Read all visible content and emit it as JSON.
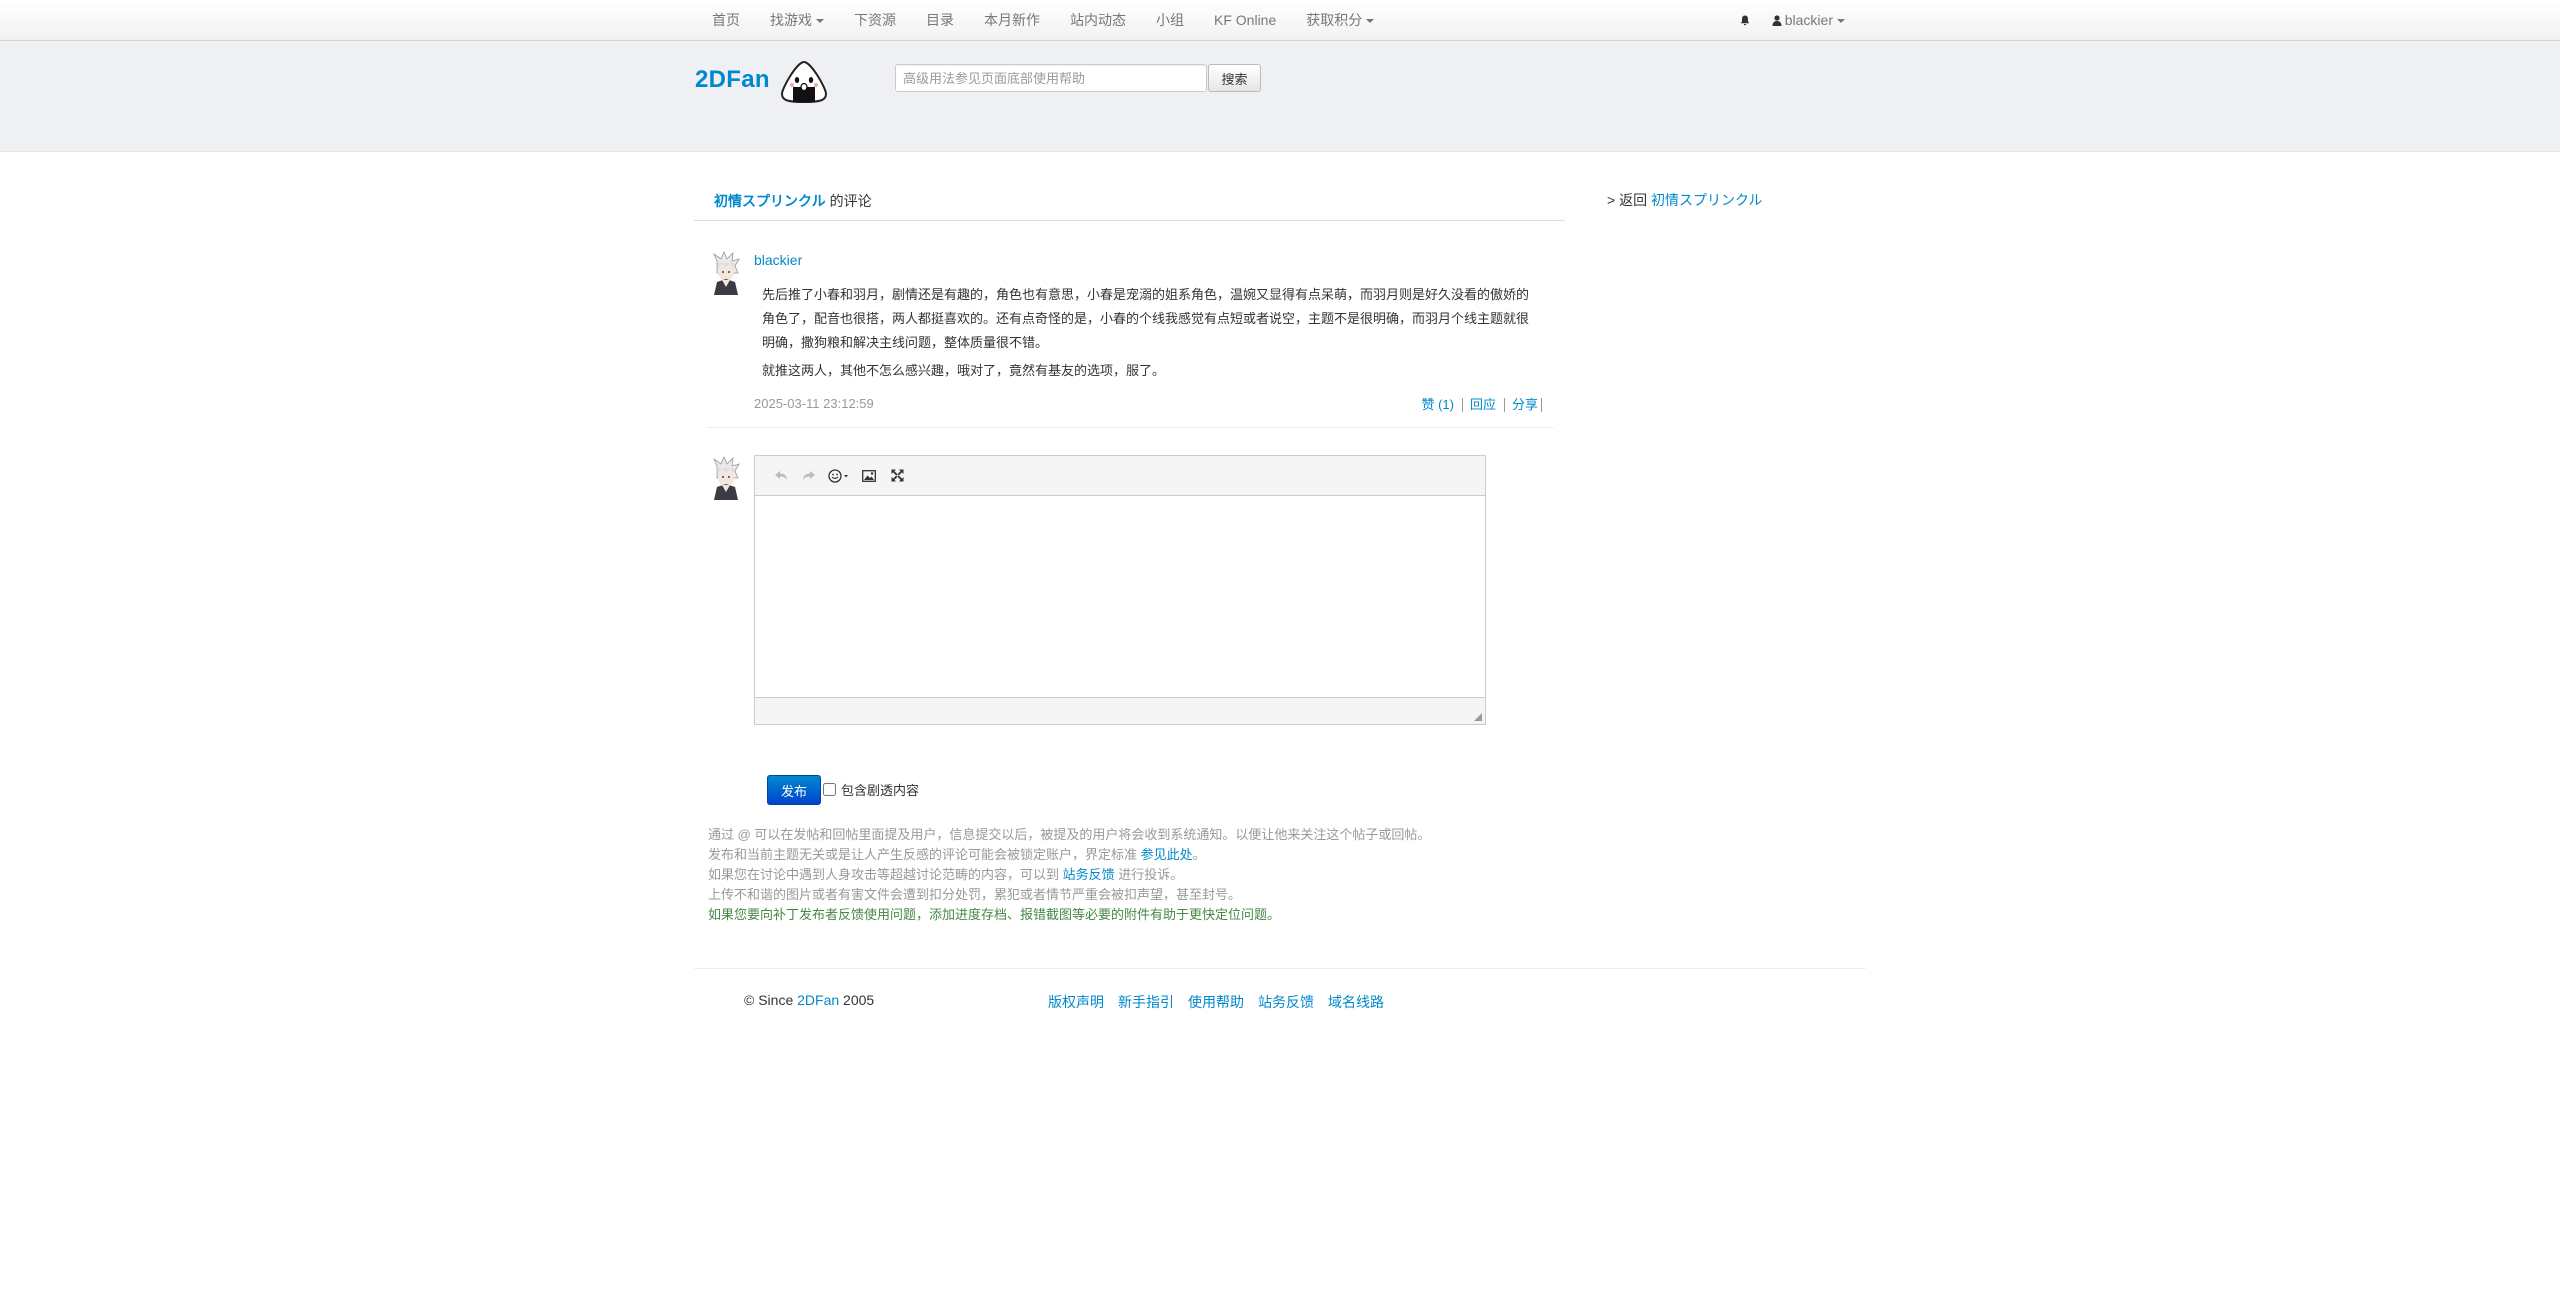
{
  "navbar": {
    "items": [
      {
        "label": "首页"
      },
      {
        "label": "找游戏",
        "dropdown": true
      },
      {
        "label": "下资源"
      },
      {
        "label": "目录"
      },
      {
        "label": "本月新作"
      },
      {
        "label": "站内动态"
      },
      {
        "label": "小组"
      },
      {
        "label": "KF Online"
      },
      {
        "label": "获取积分",
        "dropdown": true
      }
    ],
    "user": "blackier"
  },
  "header": {
    "logo_text": "2DFan",
    "search_placeholder": "高级用法参见页面底部使用帮助",
    "search_button": "搜索"
  },
  "heading": {
    "subject": "初情スプリンクル",
    "suffix": "的评论"
  },
  "sidebar": {
    "back_prefix": "> 返回",
    "back_link": "初情スプリンクル"
  },
  "comment": {
    "author": "blackier",
    "paragraphs": [
      "先后推了小春和羽月，剧情还是有趣的，角色也有意思，小春是宠溺的姐系角色，温婉又显得有点呆萌，而羽月则是好久没看的傲娇的角色了，配音也很搭，两人都挺喜欢的。还有点奇怪的是，小春的个线我感觉有点短或者说空，主题不是很明确，而羽月个线主题就很明确，撒狗粮和解决主线问题，整体质量很不错。",
      "就推这两人，其他不怎么感兴趣，哦对了，竟然有基友的选项，服了。"
    ],
    "time": "2025-03-11 23:12:59",
    "actions": {
      "like": "赞 (1)",
      "reply": "回应",
      "share": "分享"
    }
  },
  "editor": {
    "tools": [
      "undo-icon",
      "redo-icon",
      "emoji-icon",
      "image-icon",
      "fullscreen-icon"
    ]
  },
  "form": {
    "publish": "发布",
    "spoiler_label": "包含剧透内容"
  },
  "notes": {
    "line1": "通过 @ 可以在发帖和回帖里面提及用户，信息提交以后，被提及的用户将会收到系统通知。以便让他来关注这个帖子或回帖。",
    "line2_prefix": "发布和当前主题无关或是让人产生反感的评论可能会被锁定账户，界定标准",
    "line2_link": "参见此处",
    "line2_suffix": "。",
    "line3_prefix": "如果您在讨论中遇到人身攻击等超越讨论范畴的内容，可以到",
    "line3_link": "站务反馈",
    "line3_suffix": "进行投诉。",
    "line4": "上传不和谐的图片或者有害文件会遭到扣分处罚，累犯或者情节严重会被扣声望，甚至封号。",
    "line5": "如果您要向补丁发布者反馈使用问题，添加进度存档、报错截图等必要的附件有助于更快定位问题。"
  },
  "footer": {
    "copy_prefix": "© Since",
    "copy_brand": "2DFan",
    "copy_year": "2005",
    "links": [
      "版权声明",
      "新手指引",
      "使用帮助",
      "站务反馈",
      "域名线路"
    ]
  },
  "colors": {
    "link": "#0088cc",
    "muted": "#999999",
    "green_note": "#468847",
    "header_bg": "#eef0f3",
    "primary_button": "#0055cc"
  }
}
